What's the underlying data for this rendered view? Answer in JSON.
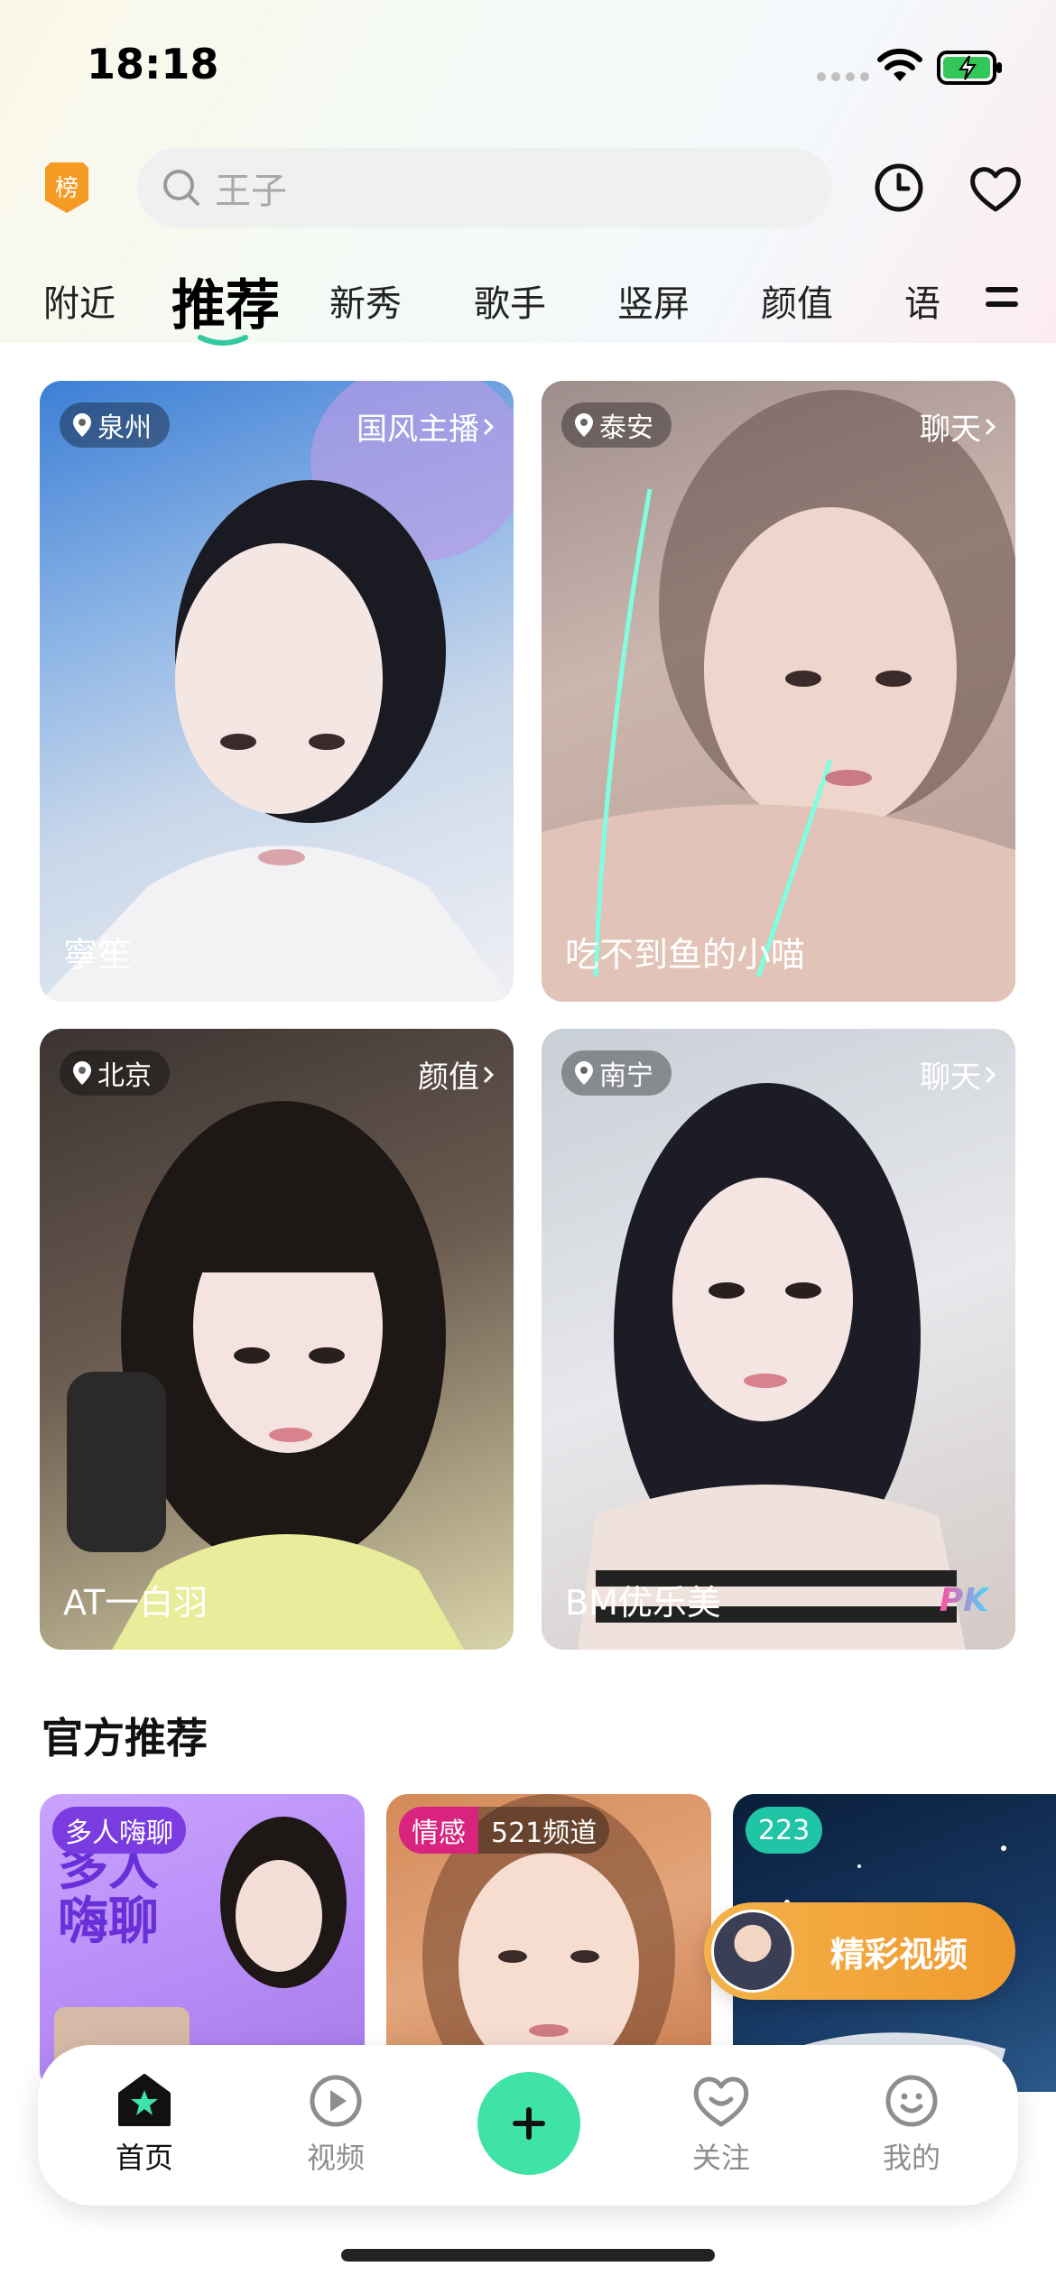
{
  "status_bar": {
    "time": "18:18"
  },
  "header": {
    "rank_badge_label": "榜",
    "search_placeholder": "王子"
  },
  "tabs": [
    {
      "label": "附近"
    },
    {
      "label": "推荐",
      "active": true
    },
    {
      "label": "新秀"
    },
    {
      "label": "歌手"
    },
    {
      "label": "竖屏"
    },
    {
      "label": "颜值"
    },
    {
      "label": "语"
    }
  ],
  "cards": [
    {
      "location": "泉州",
      "category": "国风主播",
      "name": "寧笙"
    },
    {
      "location": "泰安",
      "category": "聊天",
      "name": "吃不到鱼的小喵"
    },
    {
      "location": "北京",
      "category": "颜值",
      "name": "AT一白羽"
    },
    {
      "location": "南宁",
      "category": "聊天",
      "name": "BM优乐美",
      "badge": "PK"
    }
  ],
  "official": {
    "title": "官方推荐",
    "cards": [
      {
        "badge": "多人嗨聊",
        "overlay_text": "多人嗨聊"
      },
      {
        "badge": "情感",
        "badge_extra": "521频道"
      },
      {
        "badge": "223"
      }
    ]
  },
  "floating_button": {
    "label": "精彩视频"
  },
  "bottom_nav": [
    {
      "label": "首页",
      "icon": "home-icon",
      "active": true
    },
    {
      "label": "视频",
      "icon": "video-play-icon"
    },
    {
      "label": "",
      "icon": "plus-icon"
    },
    {
      "label": "关注",
      "icon": "follow-heart-icon"
    },
    {
      "label": "我的",
      "icon": "profile-smile-icon"
    }
  ],
  "colors": {
    "accent": "#3fe3a7",
    "tab_underline": "#33c9a0",
    "rank_badge": "#f59a23",
    "floating_button": "#f2a63a"
  }
}
